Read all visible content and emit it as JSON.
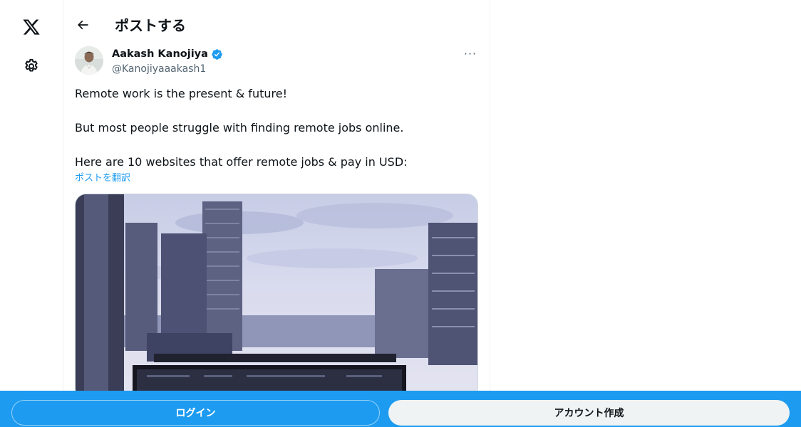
{
  "nav": {
    "logo_icon": "x-logo-icon",
    "settings_icon": "gear-icon"
  },
  "header": {
    "back_icon": "arrow-left-icon",
    "title": "ポストする"
  },
  "post": {
    "author": {
      "display_name": "Aakash Kanojiya",
      "handle": "@Kanojiyaaakash1",
      "verified": true,
      "verified_color": "#1d9bf0"
    },
    "more_label": "···",
    "text_lines": [
      "Remote work is the present & future!",
      "But most people struggle with finding remote jobs online.",
      "Here are 10 websites that offer remote jobs & pay in USD:"
    ],
    "translate_label": "ポストを翻訳"
  },
  "bottom_bar": {
    "login_label": "ログイン",
    "signup_label": "アカウント作成",
    "background": "#1d9bf0"
  }
}
